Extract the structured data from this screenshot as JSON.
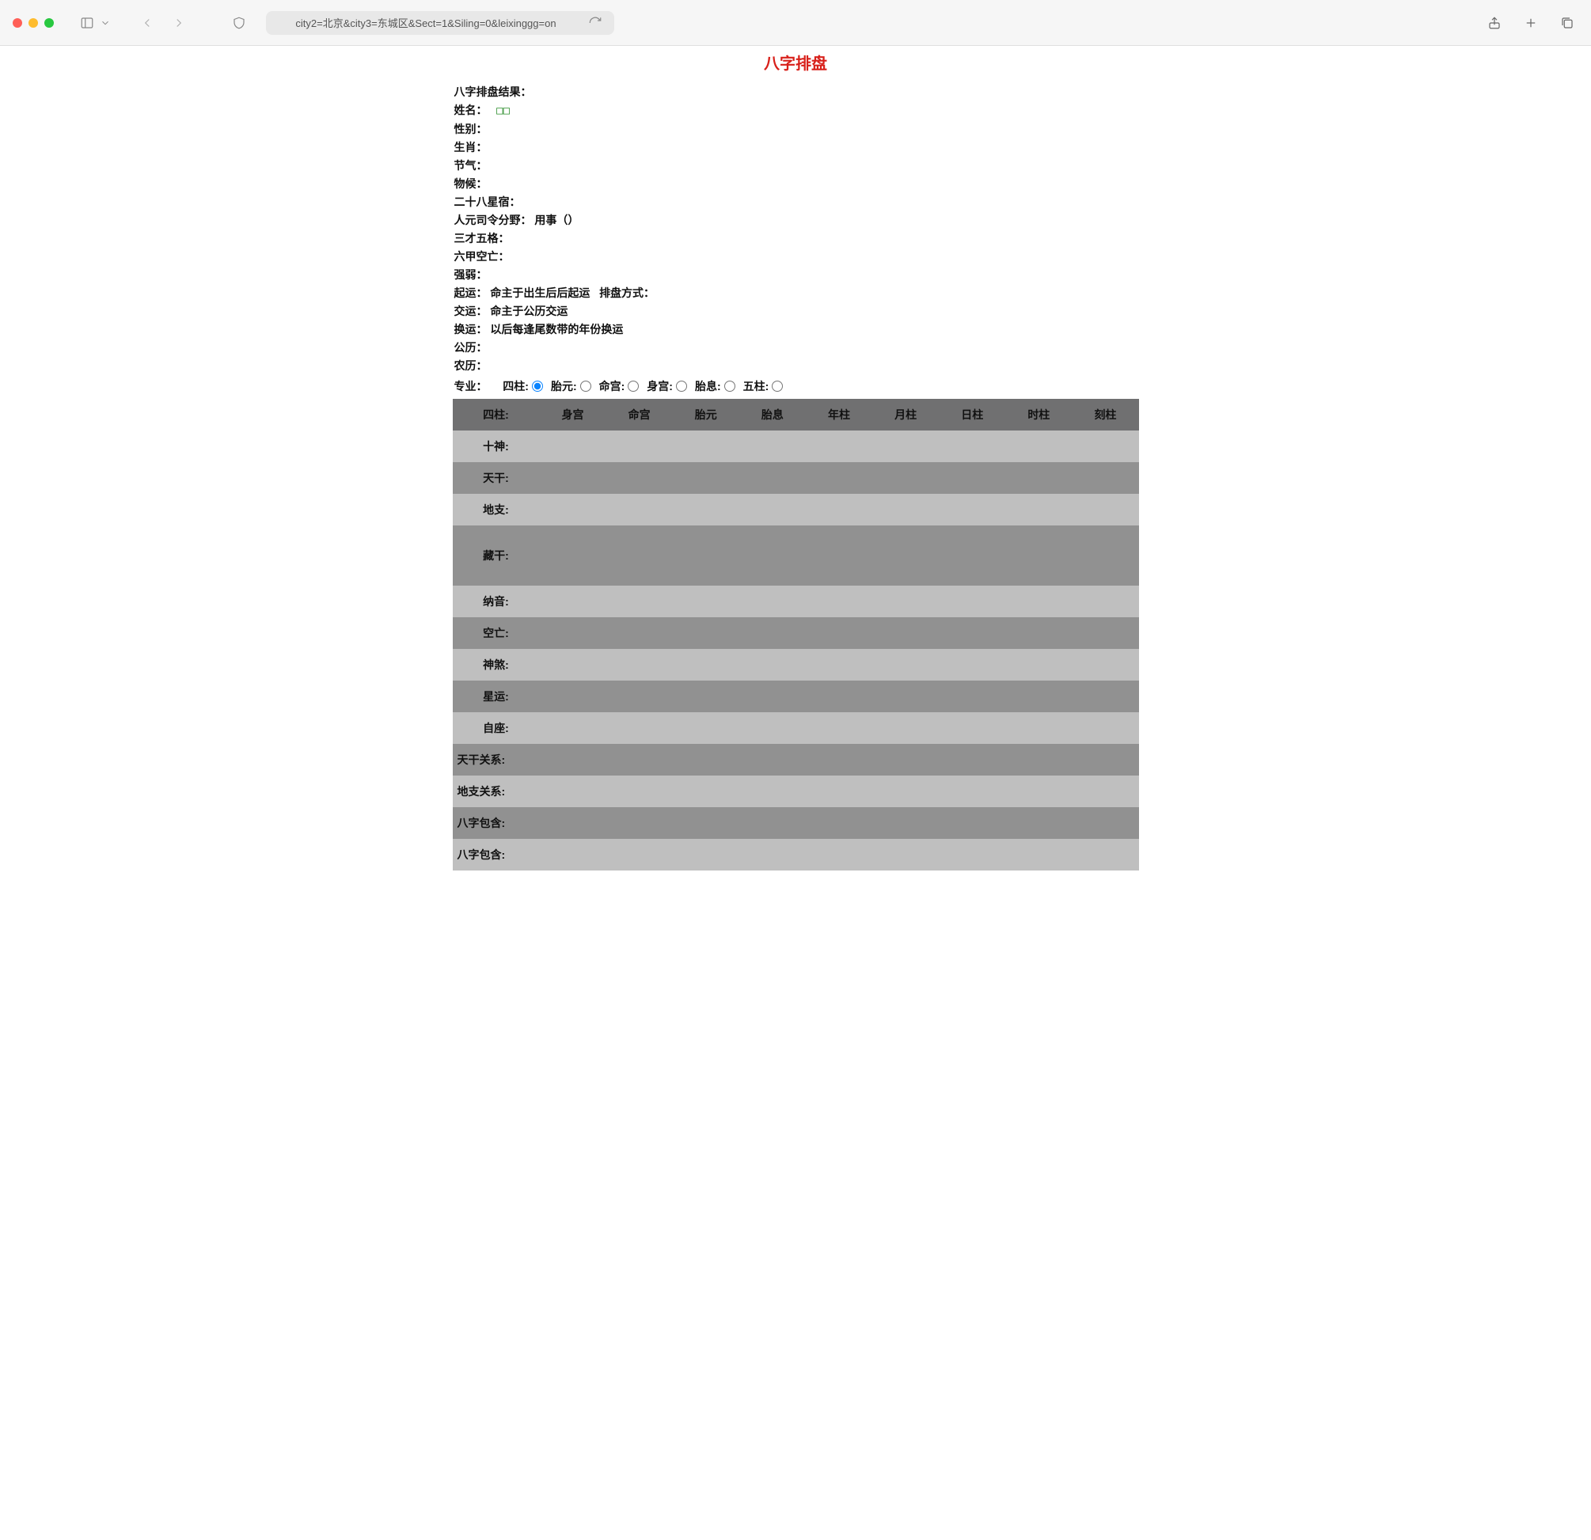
{
  "chrome": {
    "url": "city2=北京&city3=东城区&Sect=1&Siling=0&leixinggg=on"
  },
  "page": {
    "title": "八字排盘",
    "info": {
      "result_label": "八字排盘结果：",
      "name_label": "姓名：",
      "name_value": "□□",
      "gender_label": "性别：",
      "zodiac_label": "生肖：",
      "jieqi_label": "节气：",
      "wuhou_label": "物候：",
      "constellation28_label": "二十八星宿：",
      "renyuan_label": "人元司令分野：",
      "renyuan_value": "用事（）",
      "sancai_label": "三才五格：",
      "liujia_label": "六甲空亡：",
      "qiangruo_label": "强弱：",
      "qiyun_label": "起运：",
      "qiyun_value": "命主于出生后后起运",
      "paipan_method_label": "排盘方式：",
      "jiaoyun_label": "交运：",
      "jiaoyun_value": "命主于公历交运",
      "huanyun_label": "换运：",
      "huanyun_value": "以后每逢尾数带的年份换运",
      "gongli_label": "公历：",
      "nongli_label": "农历："
    },
    "radios": {
      "group_label": "专业：",
      "options": [
        {
          "label": "四柱:",
          "checked": true
        },
        {
          "label": "胎元:",
          "checked": false
        },
        {
          "label": "命宫:",
          "checked": false
        },
        {
          "label": "身宫:",
          "checked": false
        },
        {
          "label": "胎息:",
          "checked": false
        },
        {
          "label": "五柱:",
          "checked": false
        }
      ]
    },
    "table": {
      "headers": [
        "四柱:",
        "身宫",
        "命宫",
        "胎元",
        "胎息",
        "年柱",
        "月柱",
        "日柱",
        "时柱",
        "刻柱"
      ],
      "rows": [
        {
          "label": "十神:",
          "cls": "odd"
        },
        {
          "label": "天干:",
          "cls": "even"
        },
        {
          "label": "地支:",
          "cls": "odd"
        },
        {
          "label": "藏干:",
          "cls": "even",
          "tall": true
        },
        {
          "label": "纳音:",
          "cls": "odd"
        },
        {
          "label": "空亡:",
          "cls": "even"
        },
        {
          "label": "神煞:",
          "cls": "odd"
        },
        {
          "label": "星运:",
          "cls": "even"
        },
        {
          "label": "自座:",
          "cls": "odd"
        },
        {
          "label": "天干关系:",
          "cls": "even",
          "leftAlign": true
        },
        {
          "label": "地支关系:",
          "cls": "odd",
          "leftAlign": true
        },
        {
          "label": "八字包含:",
          "cls": "even",
          "leftAlign": true
        },
        {
          "label": "八字包含:",
          "cls": "odd",
          "leftAlign": true
        }
      ]
    }
  }
}
